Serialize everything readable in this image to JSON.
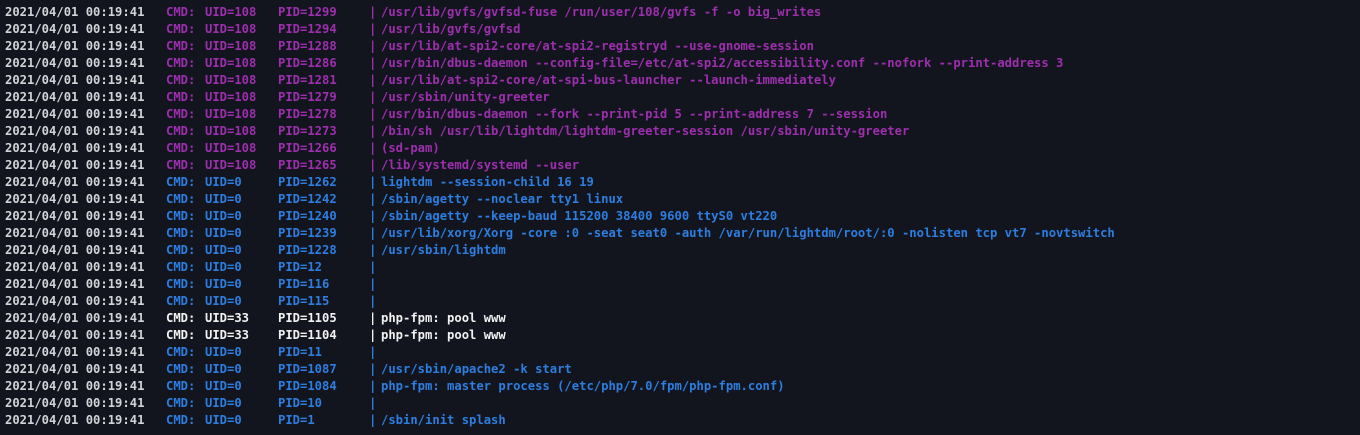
{
  "colors": {
    "background": "#12151d",
    "timestamp": "#d2d4d8",
    "uid108": "#9d2fae",
    "uid0": "#2d7ee0",
    "uid33": "#f2f2f2"
  },
  "lines": [
    {
      "ts": "2021/04/01 00:19:41",
      "cmd": "CMD:",
      "uid": "UID=108",
      "pid": "PID=1299",
      "sep": "|",
      "cmdline": "/usr/lib/gvfs/gvfsd-fuse /run/user/108/gvfs -f -o big_writes",
      "color": "purple"
    },
    {
      "ts": "2021/04/01 00:19:41",
      "cmd": "CMD:",
      "uid": "UID=108",
      "pid": "PID=1294",
      "sep": "|",
      "cmdline": "/usr/lib/gvfs/gvfsd",
      "color": "purple"
    },
    {
      "ts": "2021/04/01 00:19:41",
      "cmd": "CMD:",
      "uid": "UID=108",
      "pid": "PID=1288",
      "sep": "|",
      "cmdline": "/usr/lib/at-spi2-core/at-spi2-registryd --use-gnome-session",
      "color": "purple"
    },
    {
      "ts": "2021/04/01 00:19:41",
      "cmd": "CMD:",
      "uid": "UID=108",
      "pid": "PID=1286",
      "sep": "|",
      "cmdline": "/usr/bin/dbus-daemon --config-file=/etc/at-spi2/accessibility.conf --nofork --print-address 3",
      "color": "purple"
    },
    {
      "ts": "2021/04/01 00:19:41",
      "cmd": "CMD:",
      "uid": "UID=108",
      "pid": "PID=1281",
      "sep": "|",
      "cmdline": "/usr/lib/at-spi2-core/at-spi-bus-launcher --launch-immediately",
      "color": "purple"
    },
    {
      "ts": "2021/04/01 00:19:41",
      "cmd": "CMD:",
      "uid": "UID=108",
      "pid": "PID=1279",
      "sep": "|",
      "cmdline": "/usr/sbin/unity-greeter",
      "color": "purple"
    },
    {
      "ts": "2021/04/01 00:19:41",
      "cmd": "CMD:",
      "uid": "UID=108",
      "pid": "PID=1278",
      "sep": "|",
      "cmdline": "/usr/bin/dbus-daemon --fork --print-pid 5 --print-address 7 --session",
      "color": "purple"
    },
    {
      "ts": "2021/04/01 00:19:41",
      "cmd": "CMD:",
      "uid": "UID=108",
      "pid": "PID=1273",
      "sep": "|",
      "cmdline": "/bin/sh /usr/lib/lightdm/lightdm-greeter-session /usr/sbin/unity-greeter",
      "color": "purple"
    },
    {
      "ts": "2021/04/01 00:19:41",
      "cmd": "CMD:",
      "uid": "UID=108",
      "pid": "PID=1266",
      "sep": "|",
      "cmdline": "(sd-pam)",
      "color": "purple"
    },
    {
      "ts": "2021/04/01 00:19:41",
      "cmd": "CMD:",
      "uid": "UID=108",
      "pid": "PID=1265",
      "sep": "|",
      "cmdline": "/lib/systemd/systemd --user",
      "color": "purple"
    },
    {
      "ts": "2021/04/01 00:19:41",
      "cmd": "CMD:",
      "uid": "UID=0",
      "pid": "PID=1262",
      "sep": "|",
      "cmdline": "lightdm --session-child 16 19",
      "color": "blue"
    },
    {
      "ts": "2021/04/01 00:19:41",
      "cmd": "CMD:",
      "uid": "UID=0",
      "pid": "PID=1242",
      "sep": "|",
      "cmdline": "/sbin/agetty --noclear tty1 linux",
      "color": "blue"
    },
    {
      "ts": "2021/04/01 00:19:41",
      "cmd": "CMD:",
      "uid": "UID=0",
      "pid": "PID=1240",
      "sep": "|",
      "cmdline": "/sbin/agetty --keep-baud 115200 38400 9600 ttyS0 vt220",
      "color": "blue"
    },
    {
      "ts": "2021/04/01 00:19:41",
      "cmd": "CMD:",
      "uid": "UID=0",
      "pid": "PID=1239",
      "sep": "|",
      "cmdline": "/usr/lib/xorg/Xorg -core :0 -seat seat0 -auth /var/run/lightdm/root/:0 -nolisten tcp vt7 -novtswitch",
      "color": "blue"
    },
    {
      "ts": "2021/04/01 00:19:41",
      "cmd": "CMD:",
      "uid": "UID=0",
      "pid": "PID=1228",
      "sep": "|",
      "cmdline": "/usr/sbin/lightdm",
      "color": "blue"
    },
    {
      "ts": "2021/04/01 00:19:41",
      "cmd": "CMD:",
      "uid": "UID=0",
      "pid": "PID=12",
      "sep": "|",
      "cmdline": "",
      "color": "blue"
    },
    {
      "ts": "2021/04/01 00:19:41",
      "cmd": "CMD:",
      "uid": "UID=0",
      "pid": "PID=116",
      "sep": "|",
      "cmdline": "",
      "color": "blue"
    },
    {
      "ts": "2021/04/01 00:19:41",
      "cmd": "CMD:",
      "uid": "UID=0",
      "pid": "PID=115",
      "sep": "|",
      "cmdline": "",
      "color": "blue"
    },
    {
      "ts": "2021/04/01 00:19:41",
      "cmd": "CMD:",
      "uid": "UID=33",
      "pid": "PID=1105",
      "sep": "|",
      "cmdline": "php-fpm: pool www",
      "color": "white"
    },
    {
      "ts": "2021/04/01 00:19:41",
      "cmd": "CMD:",
      "uid": "UID=33",
      "pid": "PID=1104",
      "sep": "|",
      "cmdline": "php-fpm: pool www",
      "color": "white"
    },
    {
      "ts": "2021/04/01 00:19:41",
      "cmd": "CMD:",
      "uid": "UID=0",
      "pid": "PID=11",
      "sep": "|",
      "cmdline": "",
      "color": "blue"
    },
    {
      "ts": "2021/04/01 00:19:41",
      "cmd": "CMD:",
      "uid": "UID=0",
      "pid": "PID=1087",
      "sep": "|",
      "cmdline": "/usr/sbin/apache2 -k start",
      "color": "blue"
    },
    {
      "ts": "2021/04/01 00:19:41",
      "cmd": "CMD:",
      "uid": "UID=0",
      "pid": "PID=1084",
      "sep": "|",
      "cmdline": "php-fpm: master process (/etc/php/7.0/fpm/php-fpm.conf)",
      "color": "blue"
    },
    {
      "ts": "2021/04/01 00:19:41",
      "cmd": "CMD:",
      "uid": "UID=0",
      "pid": "PID=10",
      "sep": "|",
      "cmdline": "",
      "color": "blue"
    },
    {
      "ts": "2021/04/01 00:19:41",
      "cmd": "CMD:",
      "uid": "UID=0",
      "pid": "PID=1",
      "sep": "|",
      "cmdline": "/sbin/init splash",
      "color": "blue"
    }
  ]
}
